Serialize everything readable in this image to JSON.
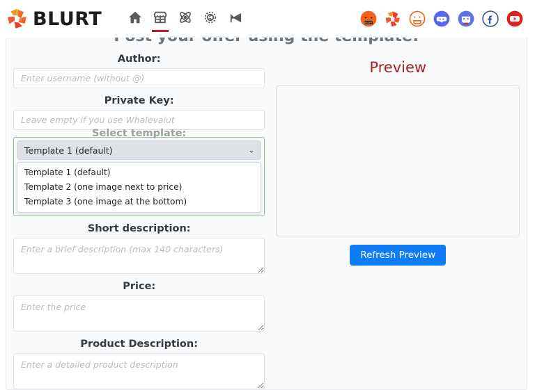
{
  "header": {
    "brand_name": "BLURT",
    "nav": [
      {
        "name": "home-icon",
        "label": "Home",
        "active": false
      },
      {
        "name": "store-icon",
        "label": "Store",
        "active": true
      },
      {
        "name": "atom-icon",
        "label": "Science",
        "active": false
      },
      {
        "name": "gear-share-icon",
        "label": "Settings",
        "active": false
      },
      {
        "name": "megaphone-icon",
        "label": "Announcements",
        "active": false
      }
    ],
    "socials": [
      {
        "name": "blurt-pumpkin-icon",
        "label": "Blurt"
      },
      {
        "name": "blurt-logo-icon",
        "label": "Blurt Logo"
      },
      {
        "name": "pumpkin-outline-icon",
        "label": "Pumpkin"
      },
      {
        "name": "discord-icon",
        "label": "Discord"
      },
      {
        "name": "telegram-robot-icon",
        "label": "Telegram"
      },
      {
        "name": "facebook-icon",
        "label": "Facebook"
      },
      {
        "name": "youtube-icon",
        "label": "YouTube"
      }
    ]
  },
  "page": {
    "title": "Post your offer using the template!"
  },
  "form": {
    "author": {
      "label": "Author:",
      "placeholder": "Enter username (without @)",
      "value": ""
    },
    "private_key": {
      "label": "Private Key:",
      "placeholder": "Leave empty if you use Whalevalut",
      "value": ""
    },
    "template": {
      "label": "Select template:",
      "selected": "Template 1 (default)",
      "caret": "⌄",
      "options": [
        "Template 1 (default)",
        "Template 2 (one image next to price)",
        "Template 3 (one image at the bottom)"
      ]
    },
    "short_description": {
      "label": "Short description:",
      "placeholder": "Enter a brief description (max 140 characters)",
      "value": ""
    },
    "price": {
      "label": "Price:",
      "placeholder": "Enter the price",
      "value": ""
    },
    "product_description": {
      "label": "Product Description:",
      "placeholder": "Enter a detailed product description",
      "value": ""
    }
  },
  "preview": {
    "title": "Preview",
    "content": "",
    "refresh_label": "Refresh Preview"
  },
  "colors": {
    "brand_orange": "#f05a28",
    "brand_red": "#e0301e",
    "accent_blue": "#0d7cf5",
    "preview_red": "#a52225",
    "focus_green": "#8bc88b",
    "nav_active": "#bb2124"
  }
}
